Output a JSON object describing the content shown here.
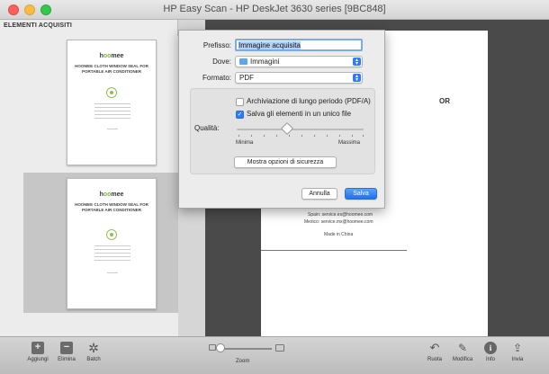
{
  "window": {
    "title": "HP Easy Scan - HP DeskJet 3630 series [9BC848]"
  },
  "sidebar": {
    "header": "ELEMENTI ACQUISITI",
    "thumbnails": [
      {
        "brand_prefix": "h",
        "brand_mid": "oo",
        "brand_suffix": "mee",
        "doc_title": "HOOMEE CLOTH WINDOW SEAL FOR PORTABLE AIR CONDITIONER",
        "selected": false
      },
      {
        "brand_prefix": "h",
        "brand_mid": "oo",
        "brand_suffix": "mee",
        "doc_title": "HOOMEE CLOTH WINDOW SEAL FOR PORTABLE AIR CONDITIONER",
        "selected": true
      }
    ]
  },
  "preview": {
    "partial_title": "OR",
    "lines": [
      "Spain:  service.es@hoomee.com",
      "Mexico:  service.mx@hoomee.com",
      "Made in China"
    ]
  },
  "dialog": {
    "prefix_label": "Prefisso:",
    "prefix_value": "Immagine acquisita",
    "location_label": "Dove:",
    "location_value": "Immagini",
    "format_label": "Formato:",
    "format_value": "PDF",
    "archive_label": "Archiviazione di lungo periodo (PDF/A)",
    "archive_checked": false,
    "single_file_label": "Salva gli elementi in un unico file",
    "single_file_checked": true,
    "quality_label": "Qualità:",
    "quality_level": 0.4,
    "quality_min": "Minima",
    "quality_max": "Massima",
    "security_button": "Mostra opzioni di sicurezza",
    "cancel_button": "Annulla",
    "save_button": "Salva",
    "accent_color": "#2d7cf6"
  },
  "toolbar": {
    "add": "Aggiungi",
    "delete": "Elimina",
    "batch": "Batch",
    "zoom": "Zoom",
    "rotate": "Ruota",
    "edit": "Modifica",
    "info": "Info",
    "send": "Invia"
  }
}
